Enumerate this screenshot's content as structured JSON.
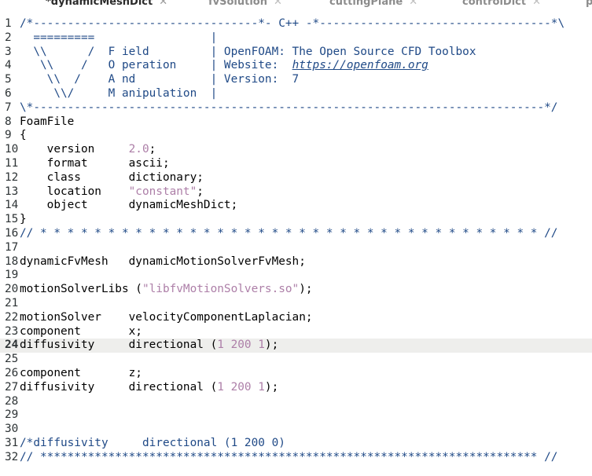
{
  "tabs": [
    {
      "label": "*dynamicMeshDict",
      "active": true
    },
    {
      "label": "fvSolution",
      "active": false
    },
    {
      "label": "cuttingPlane",
      "active": false
    },
    {
      "label": "controlDict",
      "active": false
    },
    {
      "label": "p",
      "active": false
    }
  ],
  "editor": {
    "current_line": 24,
    "colors": {
      "comment": "#204a87",
      "string": "#ad7fa8",
      "number": "#ad7fa8",
      "current_line_bg": "#eeeeec"
    },
    "lines": [
      {
        "n": "1",
        "segs": [
          {
            "t": "/*---------------------------------*- C++ -*----------------------------------*\\",
            "k": "c"
          }
        ]
      },
      {
        "n": "2",
        "segs": [
          {
            "t": "  =========                 |",
            "k": "c"
          }
        ]
      },
      {
        "n": "3",
        "segs": [
          {
            "t": "  \\\\      /  F ield         | OpenFOAM: The Open Source CFD Toolbox",
            "k": "c"
          }
        ]
      },
      {
        "n": "4",
        "segs": [
          {
            "t": "   \\\\    /   O peration     | Website:  ",
            "k": "c"
          },
          {
            "t": "https://openfoam.org",
            "k": "cu"
          }
        ]
      },
      {
        "n": "5",
        "segs": [
          {
            "t": "    \\\\  /    A nd           | Version:  7",
            "k": "c"
          }
        ]
      },
      {
        "n": "6",
        "segs": [
          {
            "t": "     \\\\/     M anipulation  |",
            "k": "c"
          }
        ]
      },
      {
        "n": "7",
        "segs": [
          {
            "t": "\\*---------------------------------------------------------------------------*/",
            "k": "c"
          }
        ]
      },
      {
        "n": "8",
        "segs": [
          {
            "t": "FoamFile",
            "k": "p"
          }
        ]
      },
      {
        "n": "9",
        "segs": [
          {
            "t": "{",
            "k": "p"
          }
        ]
      },
      {
        "n": "10",
        "segs": [
          {
            "t": "    version     ",
            "k": "p"
          },
          {
            "t": "2.0",
            "k": "n"
          },
          {
            "t": ";",
            "k": "p"
          }
        ]
      },
      {
        "n": "11",
        "segs": [
          {
            "t": "    format      ascii;",
            "k": "p"
          }
        ]
      },
      {
        "n": "12",
        "segs": [
          {
            "t": "    class       dictionary;",
            "k": "p"
          }
        ]
      },
      {
        "n": "13",
        "segs": [
          {
            "t": "    location    ",
            "k": "p"
          },
          {
            "t": "\"constant\"",
            "k": "s"
          },
          {
            "t": ";",
            "k": "p"
          }
        ]
      },
      {
        "n": "14",
        "segs": [
          {
            "t": "    object      dynamicMeshDict;",
            "k": "p"
          }
        ]
      },
      {
        "n": "15",
        "segs": [
          {
            "t": "}",
            "k": "p"
          }
        ]
      },
      {
        "n": "16",
        "segs": [
          {
            "t": "// * * * * * * * * * * * * * * * * * * * * * * * * * * * * * * * * * * * * * //",
            "k": "c"
          }
        ]
      },
      {
        "n": "17",
        "segs": []
      },
      {
        "n": "18",
        "segs": [
          {
            "t": "dynamicFvMesh   dynamicMotionSolverFvMesh;",
            "k": "p"
          }
        ]
      },
      {
        "n": "19",
        "segs": []
      },
      {
        "n": "20",
        "segs": [
          {
            "t": "motionSolverLibs (",
            "k": "p"
          },
          {
            "t": "\"libfvMotionSolvers.so\"",
            "k": "s"
          },
          {
            "t": ");",
            "k": "p"
          }
        ]
      },
      {
        "n": "21",
        "segs": []
      },
      {
        "n": "22",
        "segs": [
          {
            "t": "motionSolver    velocityComponentLaplacian;",
            "k": "p"
          }
        ]
      },
      {
        "n": "23",
        "segs": [
          {
            "t": "component       x;",
            "k": "p"
          }
        ]
      },
      {
        "n": "24",
        "segs": [
          {
            "t": "diffusivity     directional (",
            "k": "p"
          },
          {
            "t": "1 200 1",
            "k": "n"
          },
          {
            "t": ");",
            "k": "p"
          }
        ]
      },
      {
        "n": "25",
        "segs": []
      },
      {
        "n": "26",
        "segs": [
          {
            "t": "component       z;",
            "k": "p"
          }
        ]
      },
      {
        "n": "27",
        "segs": [
          {
            "t": "diffusivity     directional (",
            "k": "p"
          },
          {
            "t": "1 200 1",
            "k": "n"
          },
          {
            "t": ");",
            "k": "p"
          }
        ]
      },
      {
        "n": "28",
        "segs": []
      },
      {
        "n": "29",
        "segs": []
      },
      {
        "n": "30",
        "segs": []
      },
      {
        "n": "31",
        "segs": [
          {
            "t": "/*diffusivity     directional (1 200 0)",
            "k": "c"
          }
        ]
      },
      {
        "n": "32",
        "segs": [
          {
            "t": "// ************************************************************************* //",
            "k": "c"
          }
        ]
      }
    ]
  }
}
